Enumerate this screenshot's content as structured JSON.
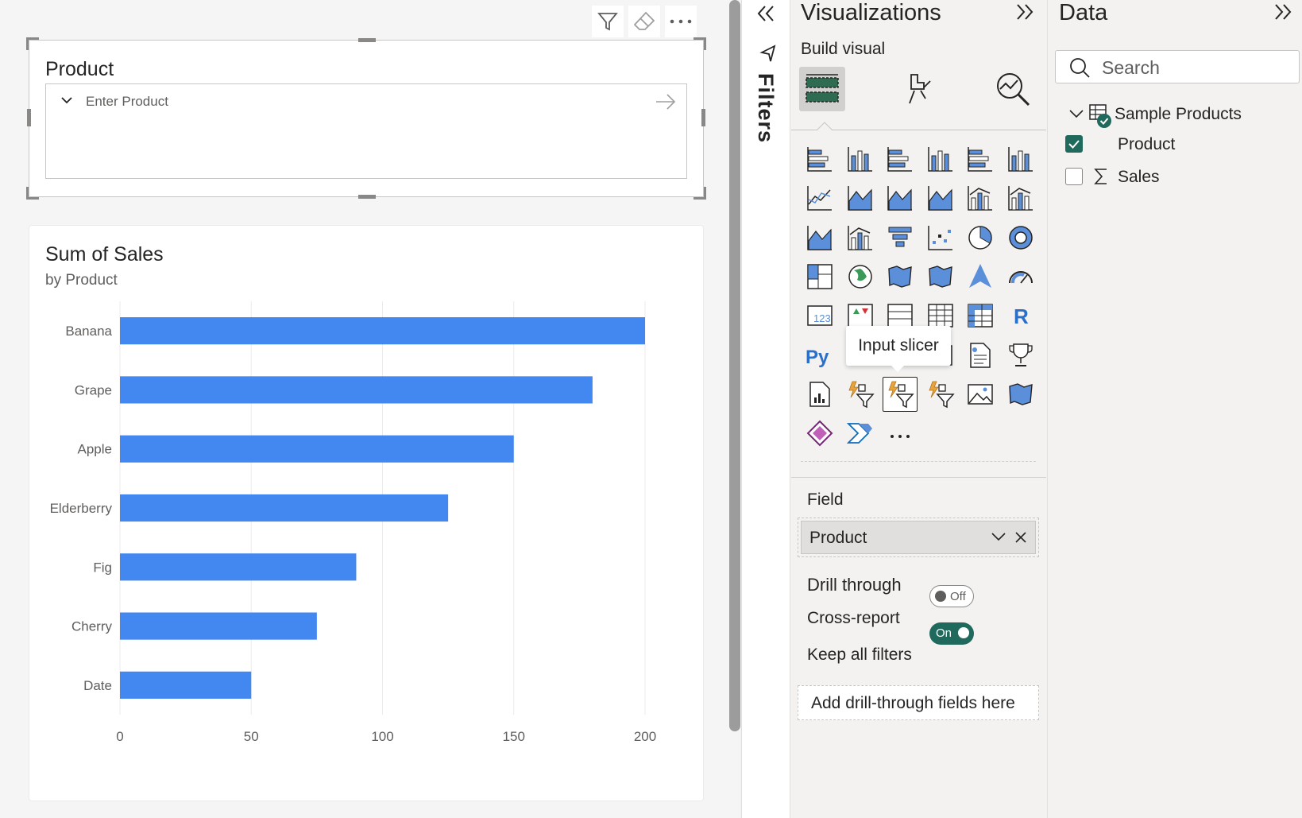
{
  "slicer": {
    "title": "Product",
    "placeholder": "Enter Product",
    "toolbar": [
      "filter-icon",
      "eraser-icon",
      "more-options-icon"
    ]
  },
  "chart": {
    "title": "Sum of Sales",
    "subtitle": "by Product"
  },
  "chart_data": {
    "type": "bar",
    "orientation": "horizontal",
    "title": "Sum of Sales",
    "subtitle": "by Product",
    "categories": [
      "Banana",
      "Grape",
      "Apple",
      "Elderberry",
      "Fig",
      "Cherry",
      "Date"
    ],
    "values": [
      200,
      180,
      150,
      125,
      90,
      75,
      50
    ],
    "xlim": [
      0,
      200
    ],
    "xticks": [
      0,
      50,
      100,
      150,
      200
    ],
    "grid": true,
    "bar_color": "#4388f0"
  },
  "filters": {
    "label": "Filters"
  },
  "visualizations": {
    "title": "Visualizations",
    "build_visual": "Build visual",
    "tooltip": "Input slicer",
    "field_label": "Field",
    "field_value": "Product",
    "drill_through": "Drill through",
    "cross_report": "Cross-report",
    "cross_report_state": "Off",
    "keep_all_filters": "Keep all filters",
    "keep_all_filters_state": "On",
    "drill_placeholder": "Add drill-through fields here",
    "more": "···"
  },
  "data_pane": {
    "title": "Data",
    "search_placeholder": "Search",
    "table": "Sample Products",
    "fields": [
      {
        "name": "Product",
        "checked": true,
        "icon": "none"
      },
      {
        "name": "Sales",
        "checked": false,
        "icon": "sigma-icon"
      }
    ]
  },
  "colors": {
    "accent": "#4388f0",
    "toggle_on": "#1f6a5c",
    "icon_blue": "#5b8fd9"
  }
}
